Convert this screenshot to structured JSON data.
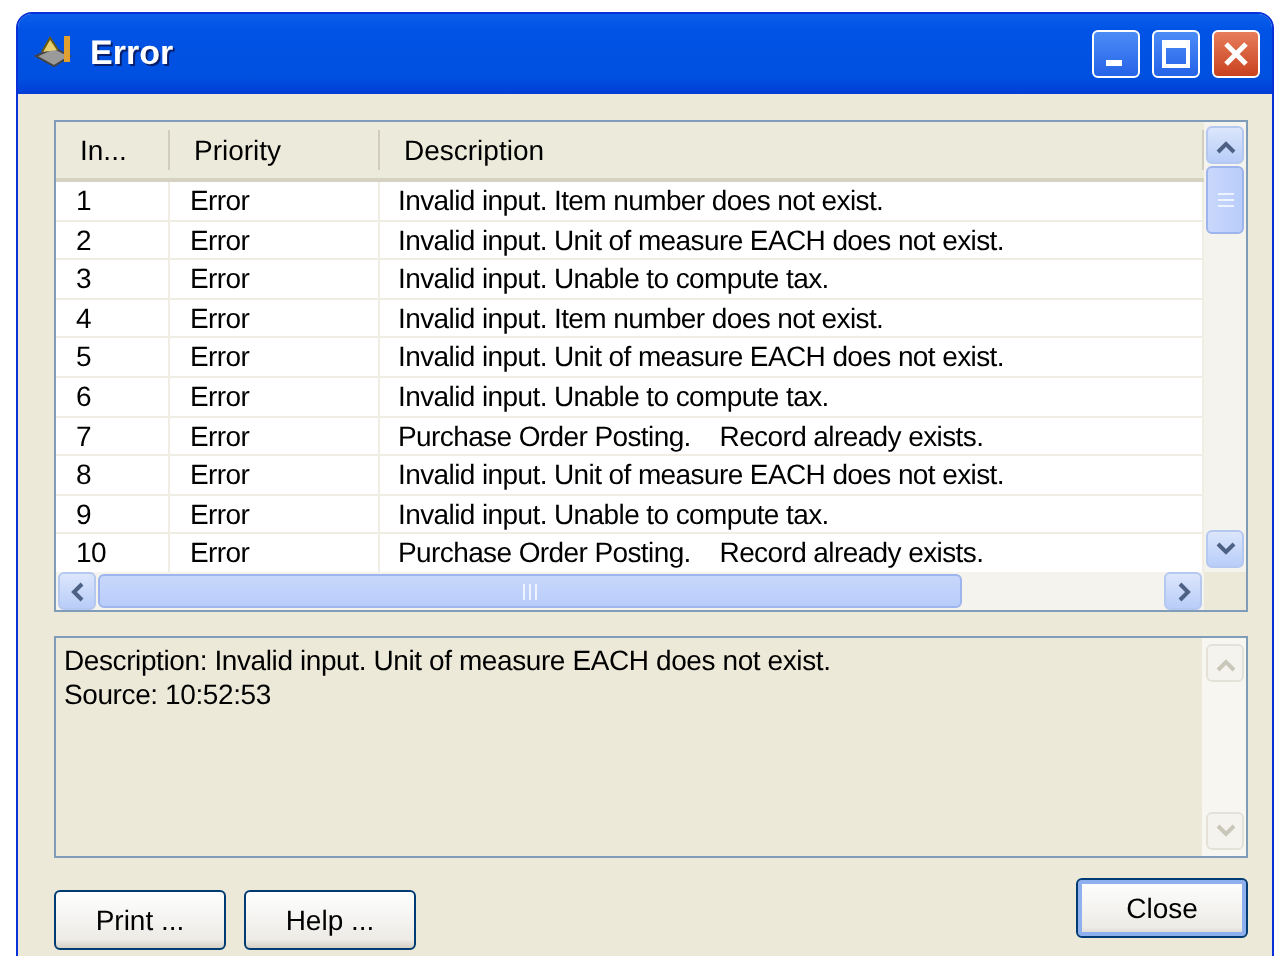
{
  "window": {
    "title": "Error"
  },
  "table": {
    "columns": [
      "In...",
      "Priority",
      "Description"
    ],
    "rows": [
      {
        "index": "1",
        "priority": "Error",
        "description": "Invalid input. Item number does not exist."
      },
      {
        "index": "2",
        "priority": "Error",
        "description": "Invalid input. Unit of measure EACH does not exist."
      },
      {
        "index": "3",
        "priority": "Error",
        "description": "Invalid input. Unable to compute tax."
      },
      {
        "index": "4",
        "priority": "Error",
        "description": "Invalid input. Item number does not exist."
      },
      {
        "index": "5",
        "priority": "Error",
        "description": "Invalid input. Unit of measure EACH does not exist."
      },
      {
        "index": "6",
        "priority": "Error",
        "description": "Invalid input. Unable to compute tax."
      },
      {
        "index": "7",
        "priority": "Error",
        "description": "Purchase Order Posting.    Record already exists."
      },
      {
        "index": "8",
        "priority": "Error",
        "description": "Invalid input. Unit of measure EACH does not exist."
      },
      {
        "index": "9",
        "priority": "Error",
        "description": "Invalid input. Unable to compute tax."
      },
      {
        "index": "10",
        "priority": "Error",
        "description": "Purchase Order Posting.    Record already exists."
      }
    ]
  },
  "details": [
    "Description: Invalid input. Unit of measure EACH does not exist.",
    "Source:  10:52:53"
  ],
  "buttons": {
    "left": [
      "Print ...",
      "Help ..."
    ],
    "right": [
      "Close"
    ]
  }
}
